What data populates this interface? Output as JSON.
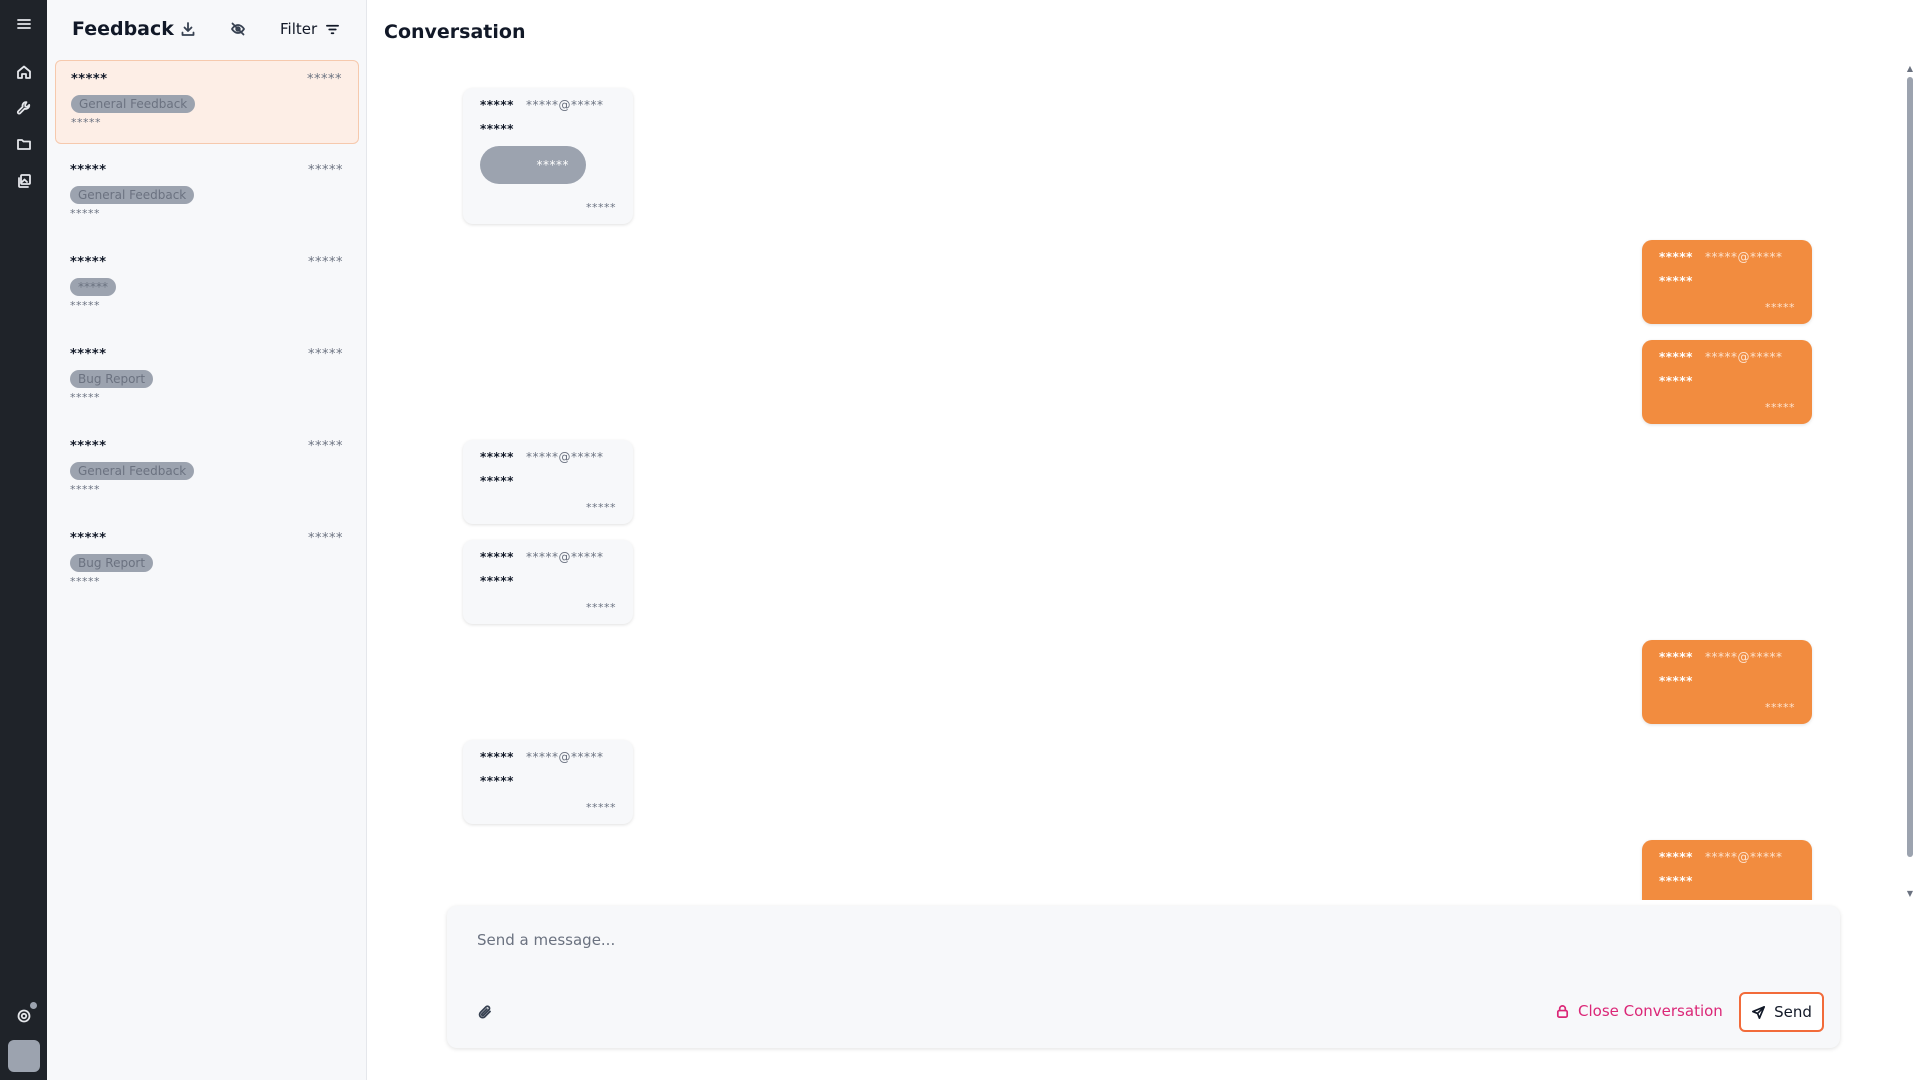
{
  "rail": {
    "icons": [
      "menu-icon",
      "home-icon",
      "wrench-icon",
      "folder-icon",
      "gallery-icon",
      "support-icon"
    ]
  },
  "list": {
    "title": "Feedback",
    "filter_label": "Filter",
    "items": [
      {
        "name": "*****",
        "time": "*****",
        "tag": "General Feedback",
        "sub": "*****",
        "active": true
      },
      {
        "name": "*****",
        "time": "*****",
        "tag": "General Feedback",
        "sub": "*****",
        "active": false
      },
      {
        "name": "*****",
        "time": "*****",
        "tag": "*****",
        "sub": "*****",
        "active": false
      },
      {
        "name": "*****",
        "time": "*****",
        "tag": "Bug Report",
        "sub": "*****",
        "active": false
      },
      {
        "name": "*****",
        "time": "*****",
        "tag": "General Feedback",
        "sub": "*****",
        "active": false
      },
      {
        "name": "*****",
        "time": "*****",
        "tag": "Bug Report",
        "sub": "*****",
        "active": false
      }
    ]
  },
  "conversation": {
    "title": "Conversation",
    "messages": [
      {
        "dir": "in",
        "name": "*****",
        "email": "*****@*****",
        "body": "*****",
        "attachment": "*****",
        "time": "*****"
      },
      {
        "dir": "out",
        "name": "*****",
        "email": "*****@*****",
        "body": "*****",
        "time": "*****"
      },
      {
        "dir": "out",
        "name": "*****",
        "email": "*****@*****",
        "body": "*****",
        "time": "*****"
      },
      {
        "dir": "in",
        "name": "*****",
        "email": "*****@*****",
        "body": "*****",
        "time": "*****"
      },
      {
        "dir": "in",
        "name": "*****",
        "email": "*****@*****",
        "body": "*****",
        "time": "*****"
      },
      {
        "dir": "out",
        "name": "*****",
        "email": "*****@*****",
        "body": "*****",
        "time": "*****"
      },
      {
        "dir": "in",
        "name": "*****",
        "email": "*****@*****",
        "body": "*****",
        "time": "*****"
      },
      {
        "dir": "out",
        "name": "*****",
        "email": "*****@*****",
        "body": "*****",
        "time": "*****"
      }
    ]
  },
  "composer": {
    "placeholder": "Send a message...",
    "close_label": "Close Conversation",
    "send_label": "Send"
  },
  "colors": {
    "accent": "#f28c3f",
    "active_item_bg": "#fdeee6",
    "close_text": "#db2777",
    "send_border": "#f26b3a"
  }
}
